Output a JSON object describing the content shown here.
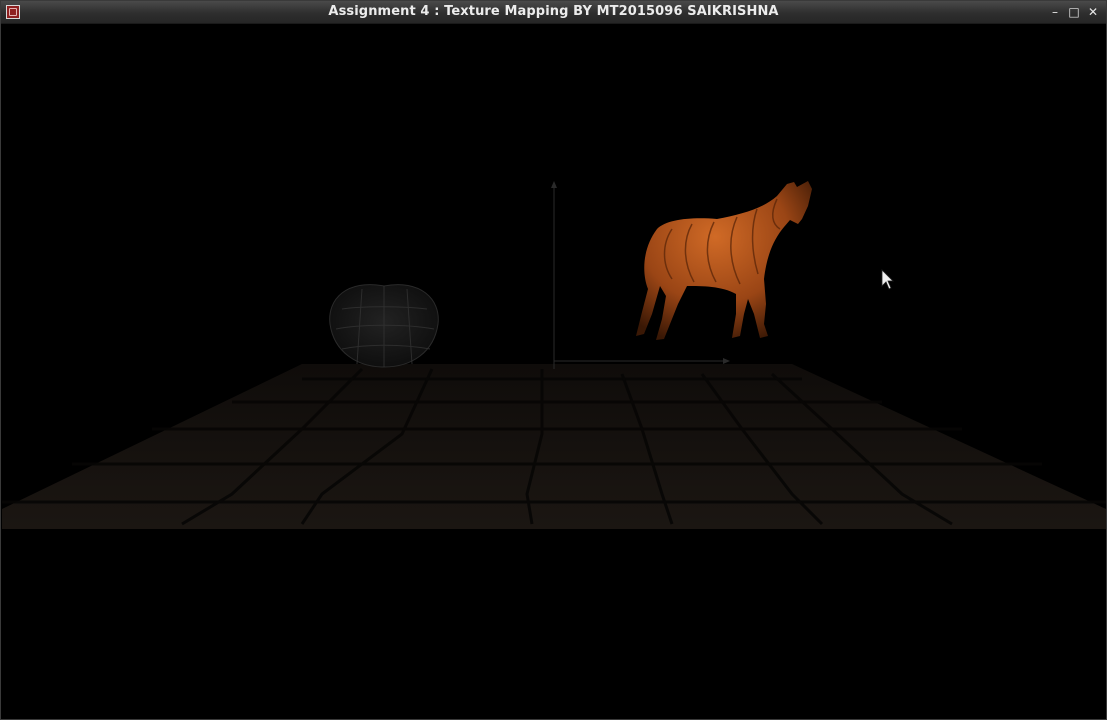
{
  "window": {
    "title": "Assignment 4 : Texture Mapping BY MT2015096 SAIKRISHNA",
    "icon": "app-icon",
    "controls": {
      "minimize": "–",
      "maximize": "□",
      "close": "✕"
    }
  },
  "scene": {
    "background_color": "#000000",
    "objects": [
      "textured-floor",
      "apple-model",
      "horse-model",
      "axis-lines"
    ],
    "horse_color": "#b5561c",
    "floor_color": "#1a1410",
    "apple_color": "#1c1c1c"
  }
}
